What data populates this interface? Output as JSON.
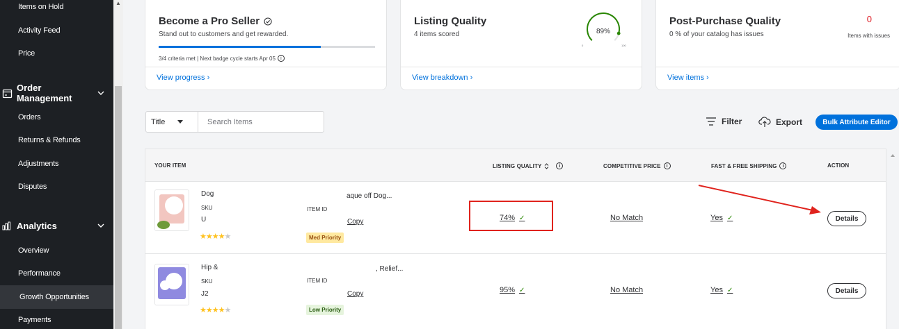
{
  "sidebar": {
    "items_top": [
      "Items on Hold",
      "Activity Feed",
      "Price"
    ],
    "order_management": {
      "label": "Order Management",
      "items": [
        "Orders",
        "Returns & Refunds",
        "Adjustments",
        "Disputes"
      ]
    },
    "analytics": {
      "label": "Analytics",
      "items": [
        "Overview",
        "Performance",
        "Growth Opportunities",
        "Payments"
      ],
      "active": "Growth Opportunities"
    }
  },
  "cards": {
    "pro_seller": {
      "title": "Become a Pro Seller",
      "subtitle": "Stand out to customers and get rewarded.",
      "progress": 0.75,
      "criteria": "3/4 criteria met | Next badge cycle starts Apr 05",
      "link": "View progress"
    },
    "listing_quality": {
      "title": "Listing Quality",
      "subtitle": "4 items scored",
      "gauge_value": "89%",
      "gauge_percent": 89,
      "gauge_min": "0",
      "gauge_max": "100",
      "link": "View breakdown"
    },
    "post_purchase": {
      "title": "Post-Purchase Quality",
      "subtitle": "0 % of your catalog has issues",
      "issues_count": "0",
      "issues_label": "Items with issues",
      "link": "View items"
    }
  },
  "toolbar": {
    "search_type": "Title",
    "search_placeholder": "Search Items",
    "filter_label": "Filter",
    "export_label": "Export",
    "bulk_label": "Bulk Attribute Editor"
  },
  "table": {
    "headers": {
      "item": "YOUR ITEM",
      "quality": "LISTING QUALITY",
      "price": "COMPETITIVE PRICE",
      "shipping": "FAST & FREE SHIPPING",
      "action": "ACTION"
    },
    "rows": [
      {
        "name_left": "Dog",
        "name_right": "aque off Dog...",
        "sku_label": "SKU",
        "sku_value": "U",
        "item_id_label": "ITEM ID",
        "copy_label": "Copy",
        "rating": 4,
        "priority": "Med Priority",
        "priority_color": "#ffe9a0",
        "priority_text_color": "#995213",
        "quality": "74%",
        "price": "No Match",
        "shipping": "Yes",
        "action": "Details"
      },
      {
        "name_left": "Hip &",
        "name_right": ", Relief...",
        "sku_label": "SKU",
        "sku_value": "J2",
        "item_id_label": "ITEM ID",
        "copy_label": "Copy",
        "rating": 4,
        "priority": "Low Priority",
        "priority_color": "#e6f4dd",
        "priority_text_color": "#2a5d12",
        "quality": "95%",
        "price": "No Match",
        "shipping": "Yes",
        "action": "Details"
      }
    ]
  },
  "colors": {
    "brand_blue": "#0071dc",
    "annotation_red": "#e0231d",
    "success_green": "#2a8703",
    "sidebar_bg": "#1d2024"
  },
  "icons": [
    "verified-badge-icon",
    "info-icon",
    "chevron-right-icon",
    "order-box-icon",
    "analytics-bars-icon",
    "chevron-down-icon",
    "filter-lines-icon",
    "cloud-export-icon",
    "sort-arrows-icon",
    "check-icon"
  ]
}
